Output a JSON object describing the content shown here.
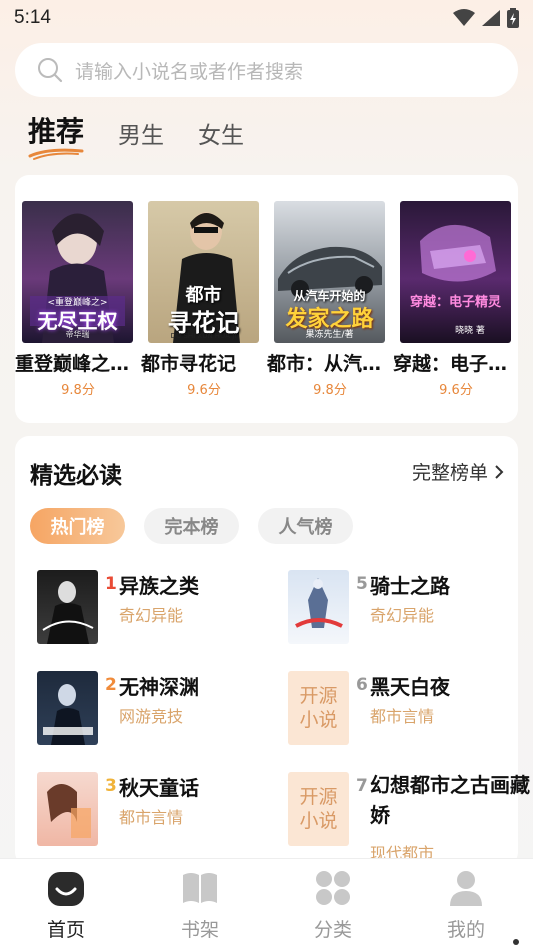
{
  "status": {
    "time": "5:14"
  },
  "search": {
    "placeholder": "请输入小说名或者作者搜索"
  },
  "tabs": [
    {
      "label": "推荐",
      "active": true
    },
    {
      "label": "男生",
      "active": false
    },
    {
      "label": "女生",
      "active": false
    }
  ],
  "recommend": [
    {
      "title": "重登巅峰之…",
      "score": "9.8分",
      "cover_text": [
        "<重登巅峰之>",
        "无尽王权"
      ],
      "cover_small": "帝华瑞"
    },
    {
      "title": "都市寻花记",
      "score": "9.6分",
      "cover_text": [
        "都市",
        "寻花记"
      ],
      "cover_small": "DU SHI XUN HUA JI"
    },
    {
      "title": "都市：从汽…",
      "score": "9.8分",
      "cover_text": [
        "从汽车开始的",
        "发家之路"
      ],
      "cover_small": "果冻先生/著"
    },
    {
      "title": "穿越：电子…",
      "score": "9.6分",
      "cover_text": [
        "穿越：电子精灵"
      ],
      "cover_small": "晓晓 著"
    }
  ],
  "selected": {
    "heading": "精选必读",
    "more_label": "完整榜单",
    "pills": [
      {
        "label": "热门榜",
        "active": true
      },
      {
        "label": "完本榜",
        "active": false
      },
      {
        "label": "人气榜",
        "active": false
      }
    ],
    "rank": [
      {
        "num": "1",
        "title": "异族之类",
        "category": "奇幻异能",
        "cover": "image"
      },
      {
        "num": "2",
        "title": "无神深渊",
        "category": "网游竞技",
        "cover": "image"
      },
      {
        "num": "3",
        "title": "秋天童话",
        "category": "都市言情",
        "cover": "image"
      },
      {
        "num": "5",
        "title": "骑士之路",
        "category": "奇幻异能",
        "cover": "image"
      },
      {
        "num": "6",
        "title": "黑天白夜",
        "category": "都市言情",
        "cover": "placeholder"
      },
      {
        "num": "7",
        "title": "幻想都市之古画藏娇",
        "category": "现代都市",
        "cover": "placeholder"
      }
    ],
    "placeholder_cover_text": "开源\n小说",
    "rank_colors": {
      "1": "#e94b35",
      "2": "#f08b3a",
      "3": "#f0b33a",
      "other": "#999999"
    }
  },
  "nav": [
    {
      "label": "首页",
      "icon": "home-icon",
      "active": true
    },
    {
      "label": "书架",
      "icon": "bookshelf-icon",
      "active": false
    },
    {
      "label": "分类",
      "icon": "category-icon",
      "active": false
    },
    {
      "label": "我的",
      "icon": "profile-icon",
      "active": false
    }
  ],
  "colors": {
    "accent": "#f6a563",
    "score": "#e7873b",
    "category": "#d9a46b"
  }
}
